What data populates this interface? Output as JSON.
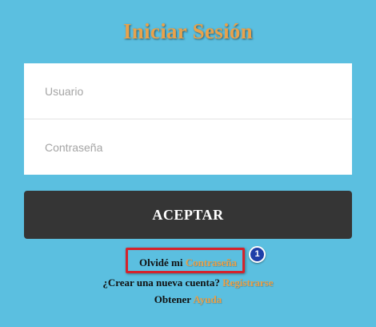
{
  "login": {
    "title": "Iniciar Sesión",
    "username": {
      "placeholder": "Usuario",
      "value": ""
    },
    "password": {
      "placeholder": "Contraseña",
      "value": ""
    },
    "submit_label": "ACEPTAR"
  },
  "links": {
    "forgot": {
      "prefix": "Olvidé mi",
      "link": "Contraseña"
    },
    "register": {
      "prefix": "¿Crear una nueva cuenta?",
      "link": "Registrarse"
    },
    "help": {
      "prefix": "Obtener",
      "link": "Ayuda"
    }
  },
  "annotation": {
    "step_number": "1"
  },
  "colors": {
    "background": "#5bbfe0",
    "accent": "#e8a24c",
    "button": "#353535",
    "highlight": "#d4232c",
    "badge": "#1e3fa8"
  }
}
